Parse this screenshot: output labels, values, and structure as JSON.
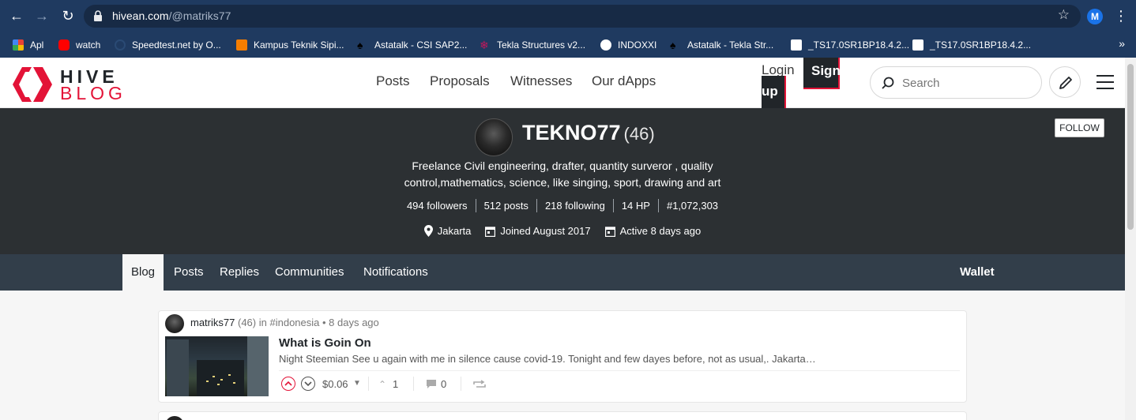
{
  "browser": {
    "url_host": "hivean.com",
    "url_path": "/@matriks77",
    "profile_initial": "M",
    "bookmarks": [
      {
        "label": "Apl",
        "icon": "apps-grid-icon",
        "color": "#e94235"
      },
      {
        "label": "watch",
        "icon": "youtube-icon",
        "color": "#ff0000"
      },
      {
        "label": "Speedtest.net by O...",
        "icon": "speedtest-icon",
        "color": "#1f3a60"
      },
      {
        "label": "Kampus Teknik Sipi...",
        "icon": "blogger-icon",
        "color": "#f57d00"
      },
      {
        "label": "Astatalk - CSI SAP2...",
        "icon": "spade-icon",
        "color": "#000000"
      },
      {
        "label": "Tekla Structures v2...",
        "icon": "tekla-icon",
        "color": "#c2185b"
      },
      {
        "label": "INDOXXI",
        "icon": "globe-icon",
        "color": "#ffffff"
      },
      {
        "label": "Astatalk - Tekla Str...",
        "icon": "spade-icon",
        "color": "#000000"
      },
      {
        "label": "_TS17.0SR1BP18.4.2...",
        "icon": "ts-icon",
        "color": "#ffffff"
      },
      {
        "label": "_TS17.0SR1BP18.4.2...",
        "icon": "ts-icon",
        "color": "#ffffff"
      }
    ],
    "bookmarks_more": "»"
  },
  "site": {
    "logo_word1": "HIVE",
    "logo_word2": "BLOG",
    "nav": [
      "Posts",
      "Proposals",
      "Witnesses",
      "Our dApps"
    ],
    "login": "Login",
    "signup_part1": "Sign",
    "signup_part2": "up",
    "search_placeholder": "Search",
    "accent": "#e31337"
  },
  "profile": {
    "name": "TEKNO77",
    "reputation": "(46)",
    "about": "Freelance Civil engineering, drafter, quantity surveror , quality control,mathematics, science, like singing, sport, drawing and art",
    "stats": [
      "494 followers",
      "512 posts",
      "218 following",
      "14 HP",
      "#1,072,303"
    ],
    "location": "Jakarta",
    "joined": "Joined August 2017",
    "active": "Active 8 days ago",
    "follow_label": "FOLLOW"
  },
  "tabs": {
    "items": [
      "Blog",
      "Posts",
      "Replies",
      "Communities",
      "Notifications"
    ],
    "active": "Blog",
    "right": "Wallet"
  },
  "post": {
    "author": "matriks77",
    "author_rep": "(46)",
    "in_text": "in",
    "community": "#indonesia",
    "age": "• 8 days ago",
    "title": "What is Goin On",
    "excerpt": "Night Steemian See u again with me in silence cause covid-19. Tonight and few dayes before, not as usual,. Jakarta…",
    "payout": "$0.06",
    "votes": "1",
    "comments": "0"
  }
}
